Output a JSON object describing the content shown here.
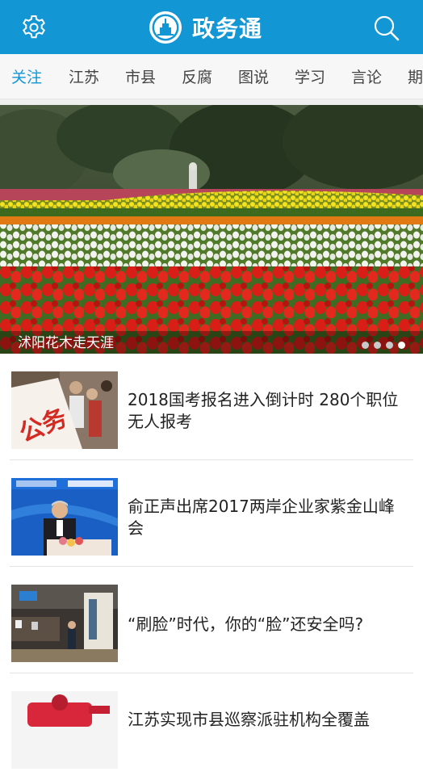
{
  "header": {
    "title": "政务通",
    "settings_icon": "gear-icon",
    "search_icon": "search-icon",
    "logo": "building-emblem-logo",
    "bar_color": "#1296d4"
  },
  "tabs": [
    {
      "label": "关注",
      "active": true
    },
    {
      "label": "江苏",
      "active": false
    },
    {
      "label": "市县",
      "active": false
    },
    {
      "label": "反腐",
      "active": false
    },
    {
      "label": "图说",
      "active": false
    },
    {
      "label": "学习",
      "active": false
    },
    {
      "label": "言论",
      "active": false
    },
    {
      "label": "期",
      "active": false
    }
  ],
  "banner": {
    "caption": "沭阳花木走天涯",
    "slide_count": 4,
    "active_slide": 4
  },
  "news": [
    {
      "title": "2018国考报名进入倒计时 280个职位无人报考"
    },
    {
      "title": "俞正声出席2017两岸企业家紫金山峰会"
    },
    {
      "title": "“刷脸”时代，你的“脸”还安全吗?"
    },
    {
      "title": "江苏实现市县巡察派驻机构全覆盖"
    }
  ]
}
